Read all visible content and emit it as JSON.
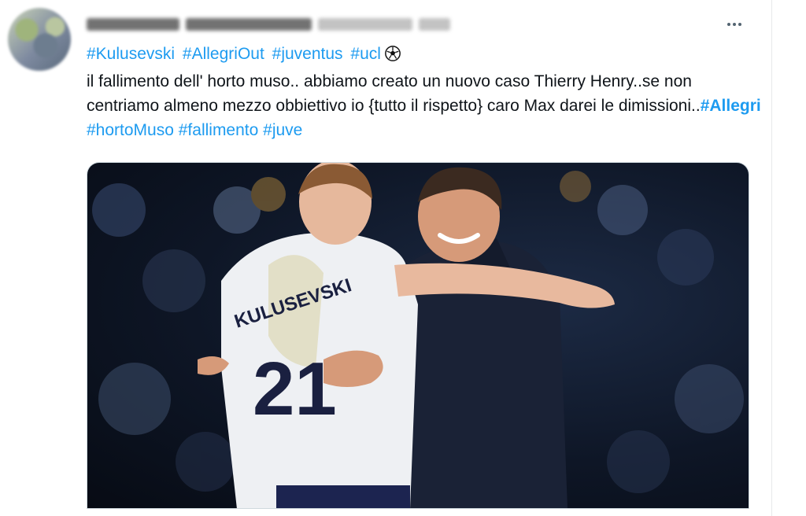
{
  "tweet": {
    "hashtags": [
      "#Kulusevski",
      "#AllegriOut",
      "#juventus",
      "#ucl"
    ],
    "body": {
      "text_1": "il fallimento dell' horto muso.. abbiamo creato un nuovo caso Thierry Henry..se non centriamo almeno mezzo obbiettivo io {tutto il rispetto} caro Max darei le dimissioni..",
      "tag_bold": "#Allegri",
      "tag_2": "#hortoMuso",
      "tag_3": "#fallimento",
      "tag_4": "#juve"
    },
    "media": {
      "jersey_name": "KULUSEVSKI",
      "jersey_number": "21"
    }
  },
  "icons": {
    "avatar": "avatar",
    "more": "more-horizontal-icon",
    "soccer": "soccer-ball-icon"
  },
  "colors": {
    "link": "#1d9bf0",
    "text": "#0f1419",
    "muted": "#536471",
    "border": "#cfd9de"
  }
}
